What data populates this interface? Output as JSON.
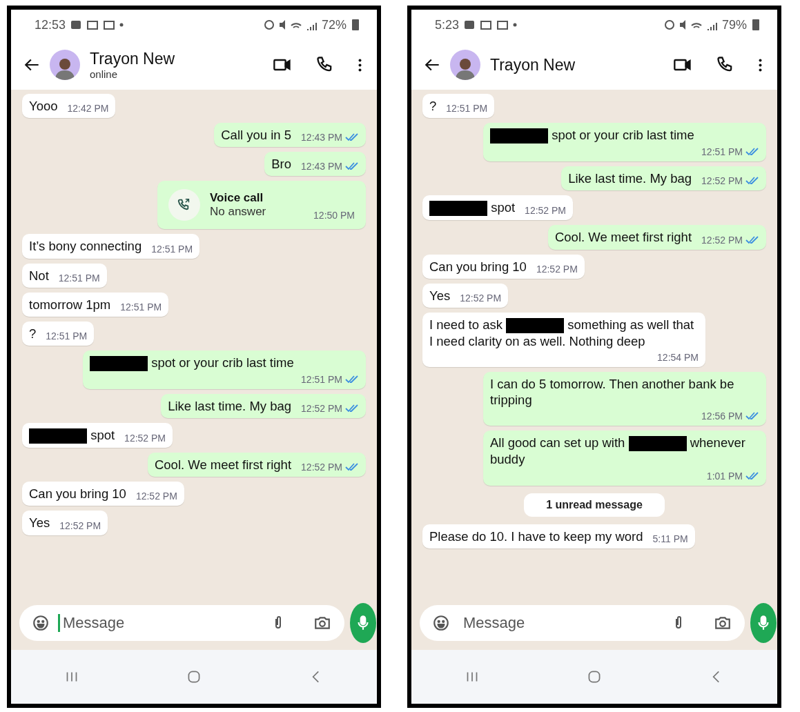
{
  "phones": [
    {
      "status_bar": {
        "time": "12:53",
        "battery": "72%"
      },
      "header": {
        "contact": "Trayon New",
        "status": "online"
      },
      "messages": [
        {
          "kind": "in",
          "segments": [
            {
              "kind": "text",
              "text": "Yooo"
            }
          ],
          "time": "12:42 PM"
        },
        {
          "kind": "out",
          "segments": [
            {
              "kind": "text",
              "text": "Call you in 5"
            }
          ],
          "time": "12:43 PM",
          "read": true
        },
        {
          "kind": "out",
          "segments": [
            {
              "kind": "text",
              "text": "Bro"
            }
          ],
          "time": "12:43 PM",
          "read": true
        },
        {
          "kind": "call",
          "title": "Voice call",
          "subtitle": "No answer",
          "time": "12:50 PM"
        },
        {
          "kind": "in",
          "segments": [
            {
              "kind": "text",
              "text": "It’s bony connecting"
            }
          ],
          "time": "12:51 PM"
        },
        {
          "kind": "in",
          "segments": [
            {
              "kind": "text",
              "text": "Not"
            }
          ],
          "time": "12:51 PM"
        },
        {
          "kind": "in",
          "segments": [
            {
              "kind": "text",
              "text": "tomorrow 1pm"
            }
          ],
          "time": "12:51 PM"
        },
        {
          "kind": "in",
          "segments": [
            {
              "kind": "text",
              "text": "?"
            }
          ],
          "time": "12:51 PM"
        },
        {
          "kind": "out",
          "segments": [
            {
              "kind": "redacted"
            },
            {
              "kind": "text",
              "text": " spot or your crib last time"
            }
          ],
          "time": "12:51 PM",
          "read": true
        },
        {
          "kind": "out",
          "segments": [
            {
              "kind": "text",
              "text": "Like last time. My bag"
            }
          ],
          "time": "12:52 PM",
          "read": true
        },
        {
          "kind": "in",
          "segments": [
            {
              "kind": "redacted"
            },
            {
              "kind": "text",
              "text": " spot"
            }
          ],
          "time": "12:52 PM"
        },
        {
          "kind": "out",
          "segments": [
            {
              "kind": "text",
              "text": "Cool. We meet first right"
            }
          ],
          "time": "12:52 PM",
          "read": true
        },
        {
          "kind": "in",
          "segments": [
            {
              "kind": "text",
              "text": "Can you bring 10"
            }
          ],
          "time": "12:52 PM"
        },
        {
          "kind": "in",
          "segments": [
            {
              "kind": "text",
              "text": "Yes"
            }
          ],
          "time": "12:52 PM"
        }
      ],
      "composer": {
        "placeholder": "Message",
        "focused": true
      }
    },
    {
      "status_bar": {
        "time": "5:23",
        "battery": "79%"
      },
      "header": {
        "contact": "Trayon New"
      },
      "messages": [
        {
          "kind": "in",
          "segments": [
            {
              "kind": "text",
              "text": "?"
            }
          ],
          "time": "12:51 PM"
        },
        {
          "kind": "out",
          "segments": [
            {
              "kind": "redacted"
            },
            {
              "kind": "text",
              "text": " spot or your crib last time"
            }
          ],
          "time": "12:51 PM",
          "read": true
        },
        {
          "kind": "out",
          "segments": [
            {
              "kind": "text",
              "text": "Like last time. My bag"
            }
          ],
          "time": "12:52 PM",
          "read": true
        },
        {
          "kind": "in",
          "segments": [
            {
              "kind": "redacted"
            },
            {
              "kind": "text",
              "text": " spot"
            }
          ],
          "time": "12:52 PM"
        },
        {
          "kind": "out",
          "segments": [
            {
              "kind": "text",
              "text": "Cool. We meet first right"
            }
          ],
          "time": "12:52 PM",
          "read": true
        },
        {
          "kind": "in",
          "segments": [
            {
              "kind": "text",
              "text": "Can you bring 10"
            }
          ],
          "time": "12:52 PM"
        },
        {
          "kind": "in",
          "segments": [
            {
              "kind": "text",
              "text": "Yes"
            }
          ],
          "time": "12:52 PM"
        },
        {
          "kind": "in",
          "segments": [
            {
              "kind": "text",
              "text": "I need to ask "
            },
            {
              "kind": "redacted"
            },
            {
              "kind": "text",
              "text": " something as well that I need clarity on as well. Nothing deep"
            }
          ],
          "time": "12:54 PM"
        },
        {
          "kind": "out",
          "segments": [
            {
              "kind": "text",
              "text": "I can do 5 tomorrow. Then another bank be tripping"
            }
          ],
          "time": "12:56 PM",
          "read": true
        },
        {
          "kind": "out",
          "segments": [
            {
              "kind": "text",
              "text": "All good can set up with "
            },
            {
              "kind": "redacted"
            },
            {
              "kind": "text",
              "text": " whenever buddy"
            }
          ],
          "time": "1:01 PM",
          "read": true
        },
        {
          "kind": "divider",
          "text": "1 unread message"
        },
        {
          "kind": "in",
          "segments": [
            {
              "kind": "text",
              "text": "Please do 10. I have to keep my word"
            }
          ],
          "time": "5:11 PM"
        }
      ],
      "composer": {
        "placeholder": "Message",
        "focused": false
      }
    }
  ]
}
